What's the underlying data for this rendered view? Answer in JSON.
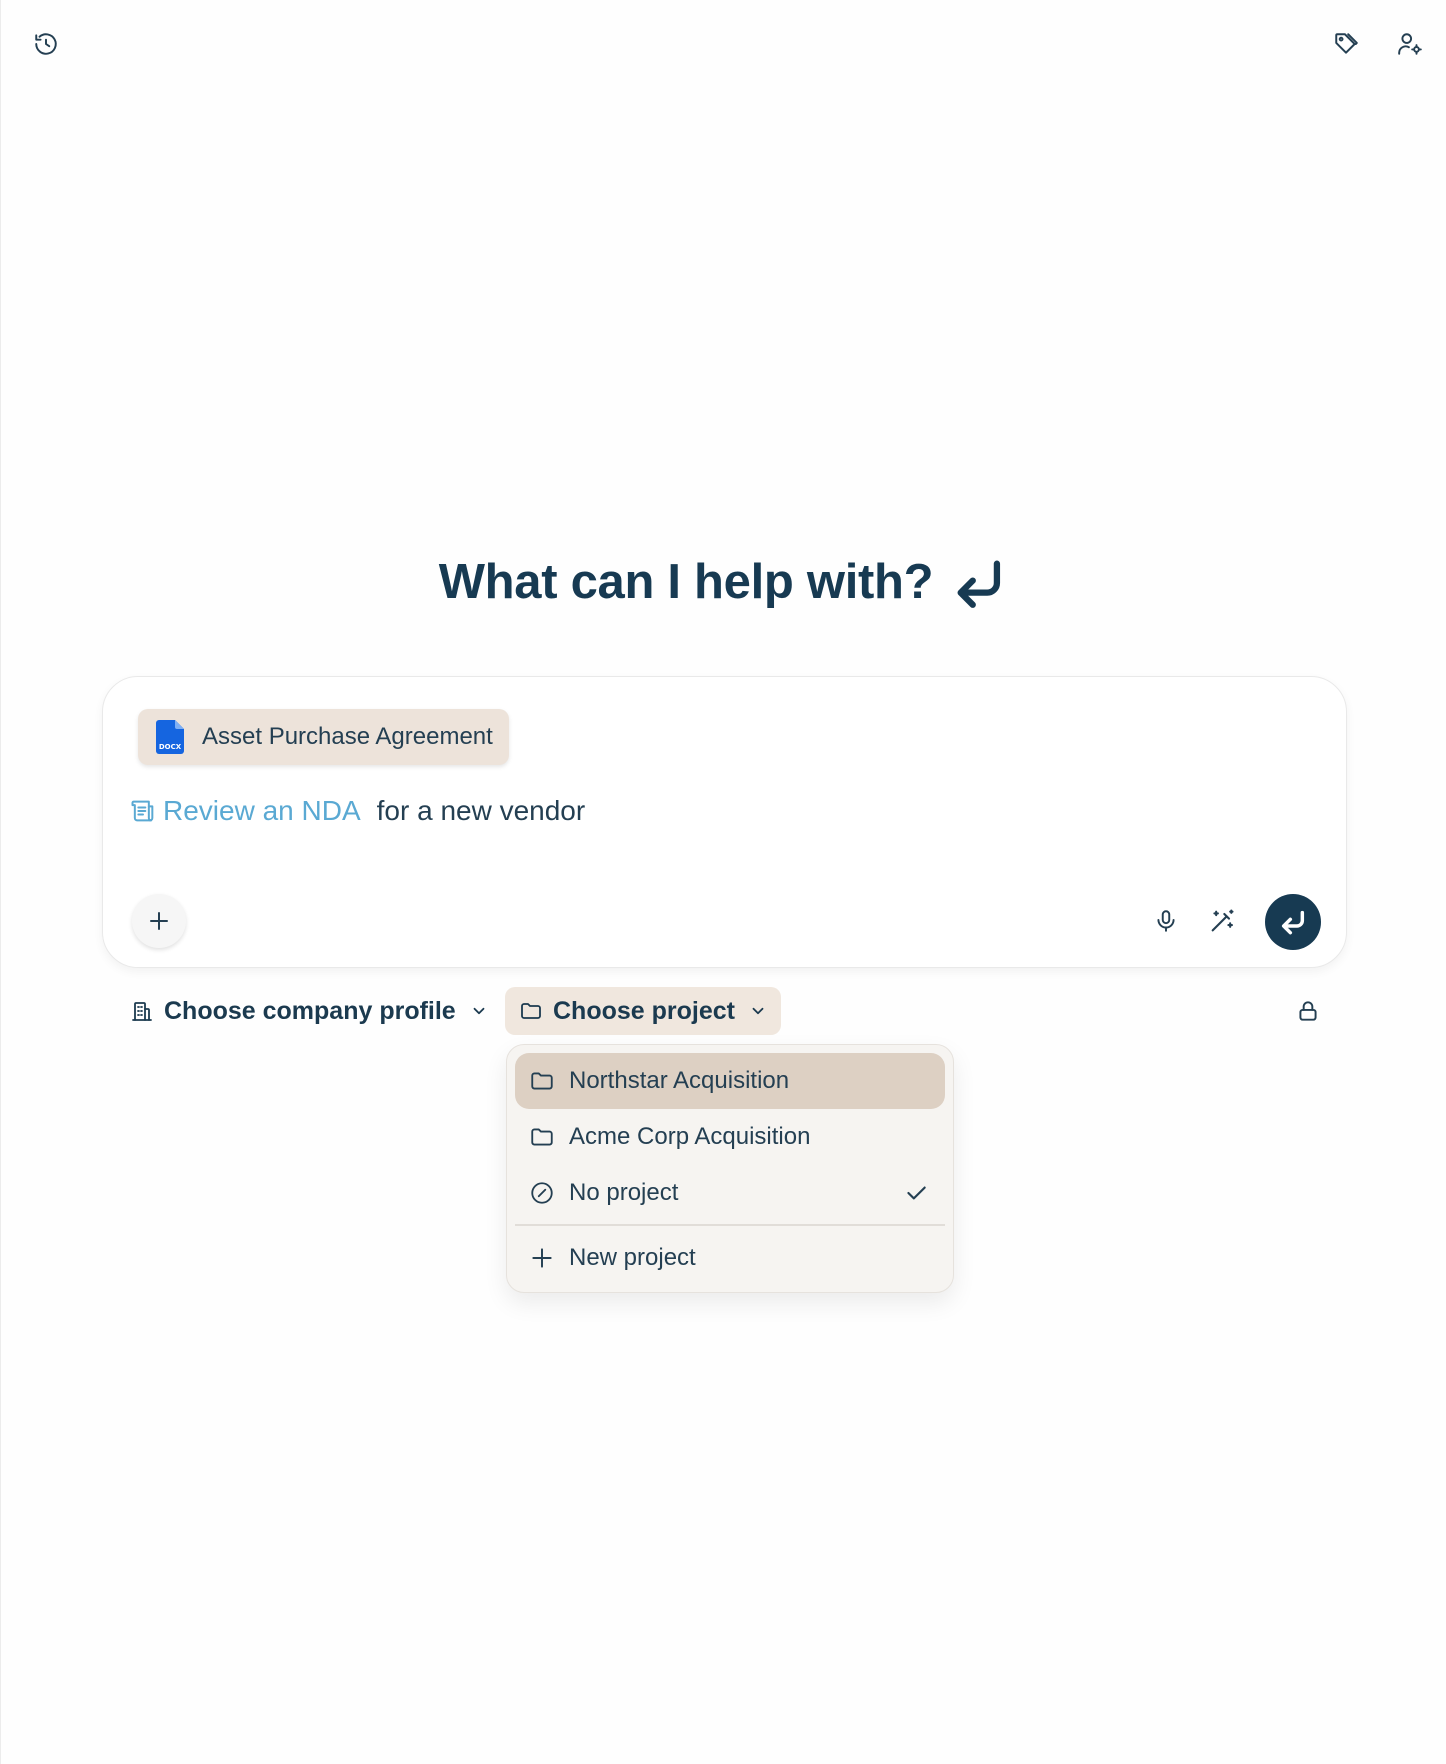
{
  "header": {
    "history_icon": "history-icon",
    "tag_icon": "tag-icon",
    "user_settings_icon": "user-settings-icon"
  },
  "hero": {
    "title": "What can I help with?",
    "icon": "return-arrow-icon"
  },
  "composer": {
    "attachment": {
      "type_label": "DOCX",
      "name": "Asset Purchase Agreement",
      "icon": "docx-file-icon"
    },
    "prompt": {
      "icon": "scroll-icon",
      "link_text": "Review an NDA",
      "rest_text": "for a new vendor"
    },
    "actions": {
      "add_icon": "plus-icon",
      "mic_icon": "microphone-icon",
      "enhance_icon": "magic-wand-icon",
      "send_icon": "send-return-icon"
    }
  },
  "selectors": {
    "company": {
      "label": "Choose company profile",
      "icon": "building-icon"
    },
    "project": {
      "label": "Choose project",
      "icon": "folder-icon"
    },
    "lock_icon": "lock-icon"
  },
  "project_menu": {
    "items": [
      {
        "label": "Northstar Acquisition",
        "icon": "folder-icon",
        "highlighted": true
      },
      {
        "label": "Acme Corp Acquisition",
        "icon": "folder-icon"
      },
      {
        "label": "No project",
        "icon": "no-entry-icon",
        "selected": true
      }
    ],
    "new_project_label": "New project"
  },
  "colors": {
    "primary": "#173a52",
    "accent_link": "#5aa9d3",
    "chip_bg": "#ede3da",
    "menu_highlight": "#ddd0c3",
    "menu_bg": "#f6f4f1"
  }
}
